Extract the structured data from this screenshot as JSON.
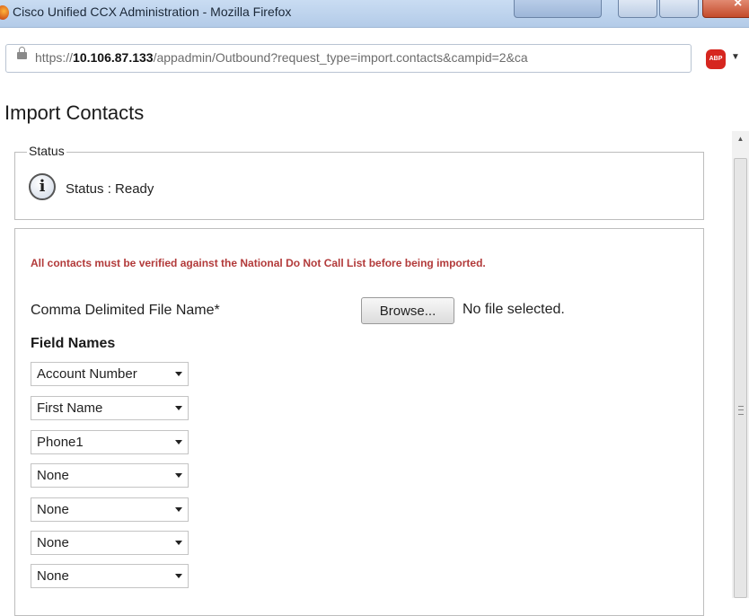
{
  "window": {
    "title": "Cisco Unified CCX Administration - Mozilla Firefox",
    "close_glyph": "×"
  },
  "browser": {
    "url_scheme": "https://",
    "url_host": "10.106.87.133",
    "url_path": "/appadmin/Outbound?request_type=import.contacts&campid=2&ca",
    "adblock_label": "ABP"
  },
  "page": {
    "title": "Import Contacts",
    "status_legend": "Status",
    "status_text": "Status : Ready",
    "warning": "All contacts must be verified against the National Do Not Call List before being imported.",
    "file_label": "Comma Delimited File Name*",
    "browse_label": "Browse...",
    "no_file_text": "No file selected.",
    "field_names_heading": "Field Names",
    "fields": [
      {
        "value": "Account Number"
      },
      {
        "value": "First Name"
      },
      {
        "value": "Phone1"
      },
      {
        "value": "None"
      },
      {
        "value": "None"
      },
      {
        "value": "None"
      },
      {
        "value": "None"
      }
    ]
  },
  "colors": {
    "warning": "#b23a3a",
    "titlebar": "#c9dcf2"
  }
}
